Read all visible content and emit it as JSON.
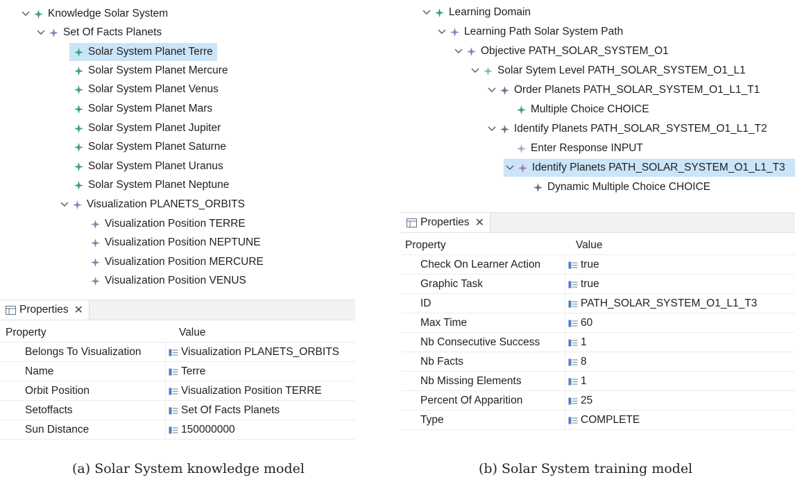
{
  "left_tree": [
    {
      "label": "Knowledge Solar System",
      "icon": "green-diamond-icon",
      "expanded": true
    },
    {
      "label": "Set Of Facts Planets",
      "icon": "purple-diamond-icon",
      "expanded": true
    },
    {
      "label": "Solar System Planet Terre",
      "icon": "green-diamond-icon",
      "selected": true
    },
    {
      "label": "Solar System Planet Mercure",
      "icon": "green-diamond-icon"
    },
    {
      "label": "Solar System Planet Venus",
      "icon": "green-diamond-icon"
    },
    {
      "label": "Solar System Planet Mars",
      "icon": "green-diamond-icon"
    },
    {
      "label": "Solar System Planet Jupiter",
      "icon": "green-diamond-icon"
    },
    {
      "label": "Solar System Planet Saturne",
      "icon": "green-diamond-icon"
    },
    {
      "label": "Solar System Planet Uranus",
      "icon": "green-diamond-icon"
    },
    {
      "label": "Solar System Planet Neptune",
      "icon": "green-diamond-icon"
    },
    {
      "label": "Visualization PLANETS_ORBITS",
      "icon": "purple-diamond-icon",
      "expanded": true
    },
    {
      "label": "Visualization Position TERRE",
      "icon": "purple-diamond-icon"
    },
    {
      "label": "Visualization Position NEPTUNE",
      "icon": "purple-diamond-icon"
    },
    {
      "label": "Visualization Position MERCURE",
      "icon": "purple-diamond-icon"
    },
    {
      "label": "Visualization Position VENUS",
      "icon": "purple-diamond-icon"
    }
  ],
  "left_props": {
    "tab_label": "Properties",
    "col_property": "Property",
    "col_value": "Value",
    "rows": [
      {
        "name": "Belongs To Visualization",
        "value": "Visualization PLANETS_ORBITS"
      },
      {
        "name": "Name",
        "value": "Terre"
      },
      {
        "name": "Orbit Position",
        "value": "Visualization Position TERRE"
      },
      {
        "name": "Setoffacts",
        "value": "Set Of Facts Planets"
      },
      {
        "name": "Sun Distance",
        "value": "150000000"
      }
    ]
  },
  "right_tree": [
    {
      "label": "Learning Domain",
      "icon": "green-diamond-icon",
      "expanded": true
    },
    {
      "label": "Learning Path Solar System Path",
      "icon": "purple-diamond-icon",
      "expanded": true
    },
    {
      "label": "Objective PATH_SOLAR_SYSTEM_O1",
      "icon": "purple-diamond-icon",
      "expanded": true
    },
    {
      "label": "Solar Sytem Level PATH_SOLAR_SYSTEM_O1_L1",
      "icon": "green-diamond-icon",
      "expanded": true
    },
    {
      "label": "Order Planets PATH_SOLAR_SYSTEM_O1_L1_T1",
      "icon": "purple-diamond-icon",
      "expanded": true
    },
    {
      "label": "Multiple Choice CHOICE",
      "icon": "green-diamond-icon"
    },
    {
      "label": "Identify Planets PATH_SOLAR_SYSTEM_O1_L1_T2",
      "icon": "purple-diamond-icon",
      "expanded": true
    },
    {
      "label": "Enter Response INPUT",
      "icon": "purple-diamond-icon"
    },
    {
      "label": "Identify Planets PATH_SOLAR_SYSTEM_O1_L1_T3",
      "icon": "purple-diamond-icon",
      "expanded": true,
      "selected": true
    },
    {
      "label": "Dynamic Multiple Choice CHOICE",
      "icon": "purple-diamond-icon"
    }
  ],
  "right_props": {
    "tab_label": "Properties",
    "col_property": "Property",
    "col_value": "Value",
    "rows": [
      {
        "name": "Check On Learner Action",
        "value": "true"
      },
      {
        "name": "Graphic Task",
        "value": "true"
      },
      {
        "name": "ID",
        "value": "PATH_SOLAR_SYSTEM_O1_L1_T3"
      },
      {
        "name": "Max Time",
        "value": "60"
      },
      {
        "name": "Nb Consecutive Success",
        "value": "1"
      },
      {
        "name": "Nb Facts",
        "value": "8"
      },
      {
        "name": "Nb Missing Elements",
        "value": "1"
      },
      {
        "name": "Percent Of Apparition",
        "value": "25"
      },
      {
        "name": "Type",
        "value": "COMPLETE"
      }
    ]
  },
  "captions": {
    "a": "(a) Solar System knowledge model",
    "b": "(b) Solar System training model"
  },
  "colors": {
    "selection": "#cce4f7",
    "green_icon": "#3aa17e",
    "purple_icon": "#9b7bb5"
  }
}
